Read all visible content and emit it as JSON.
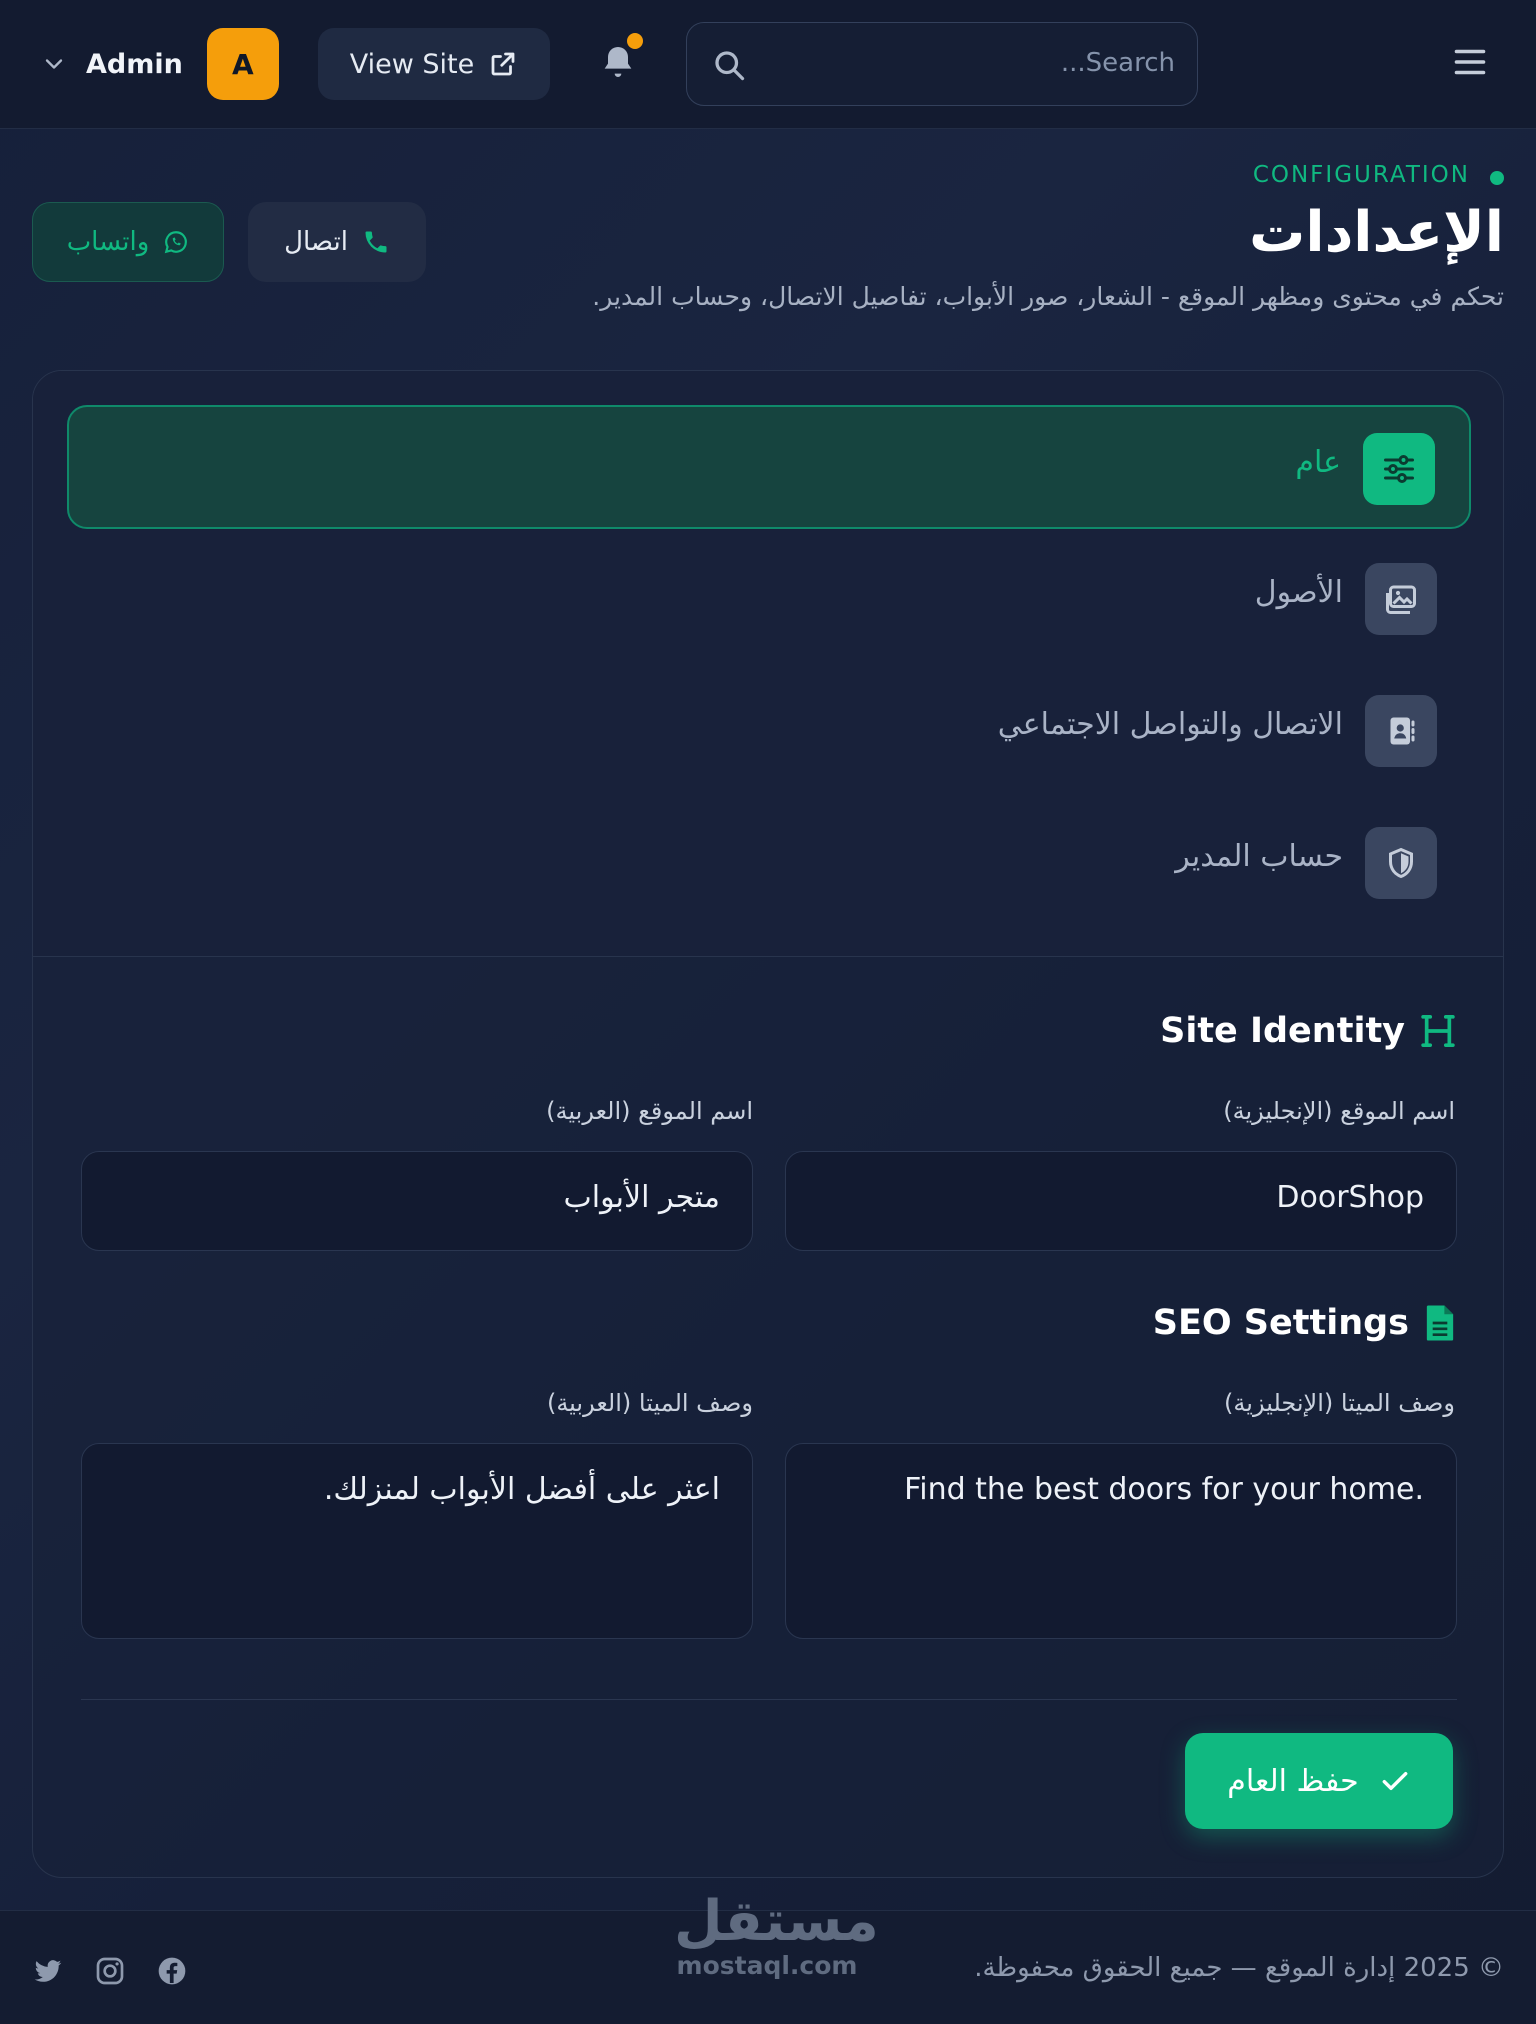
{
  "header": {
    "admin_name": "Admin",
    "avatar_initial": "A",
    "view_site_label": "View Site",
    "search_placeholder": "...Search"
  },
  "page": {
    "eyebrow": "CONFIGURATION",
    "title": "الإعدادات",
    "subtitle": "تحكم في محتوى ومظهر الموقع - الشعار، صور الأبواب، تفاصيل الاتصال، وحساب المدير.",
    "whatsapp_label": "واتساب",
    "call_label": "اتصال"
  },
  "tabs": [
    {
      "label": "عام",
      "icon": "sliders-icon",
      "active": true
    },
    {
      "label": "الأصول",
      "icon": "images-icon",
      "active": false
    },
    {
      "label": "الاتصال والتواصل الاجتماعي",
      "icon": "contact-book-icon",
      "active": false
    },
    {
      "label": "حساب المدير",
      "icon": "shield-icon",
      "active": false
    }
  ],
  "site_identity": {
    "title": "Site Identity",
    "name_en_label": "اسم الموقع (الإنجليزية)",
    "name_en_value": "DoorShop",
    "name_ar_label": "اسم الموقع (العربية)",
    "name_ar_value": "متجر الأبواب"
  },
  "seo": {
    "title": "SEO Settings",
    "desc_en_label": "وصف الميتا (الإنجليزية)",
    "desc_en_value": ".Find the best doors for your home",
    "desc_ar_label": "وصف الميتا (العربية)",
    "desc_ar_value": "اعثر على أفضل الأبواب لمنزلك."
  },
  "save_label": "حفظ العام",
  "footer": {
    "copyright": "© 2025 إدارة الموقع — جميع الحقوق محفوظة.",
    "watermark_ar": "مستقل",
    "watermark_en": "mostaql.com"
  },
  "colors": {
    "accent": "#10b981",
    "warning": "#f59e0b",
    "background": "#141d33"
  }
}
